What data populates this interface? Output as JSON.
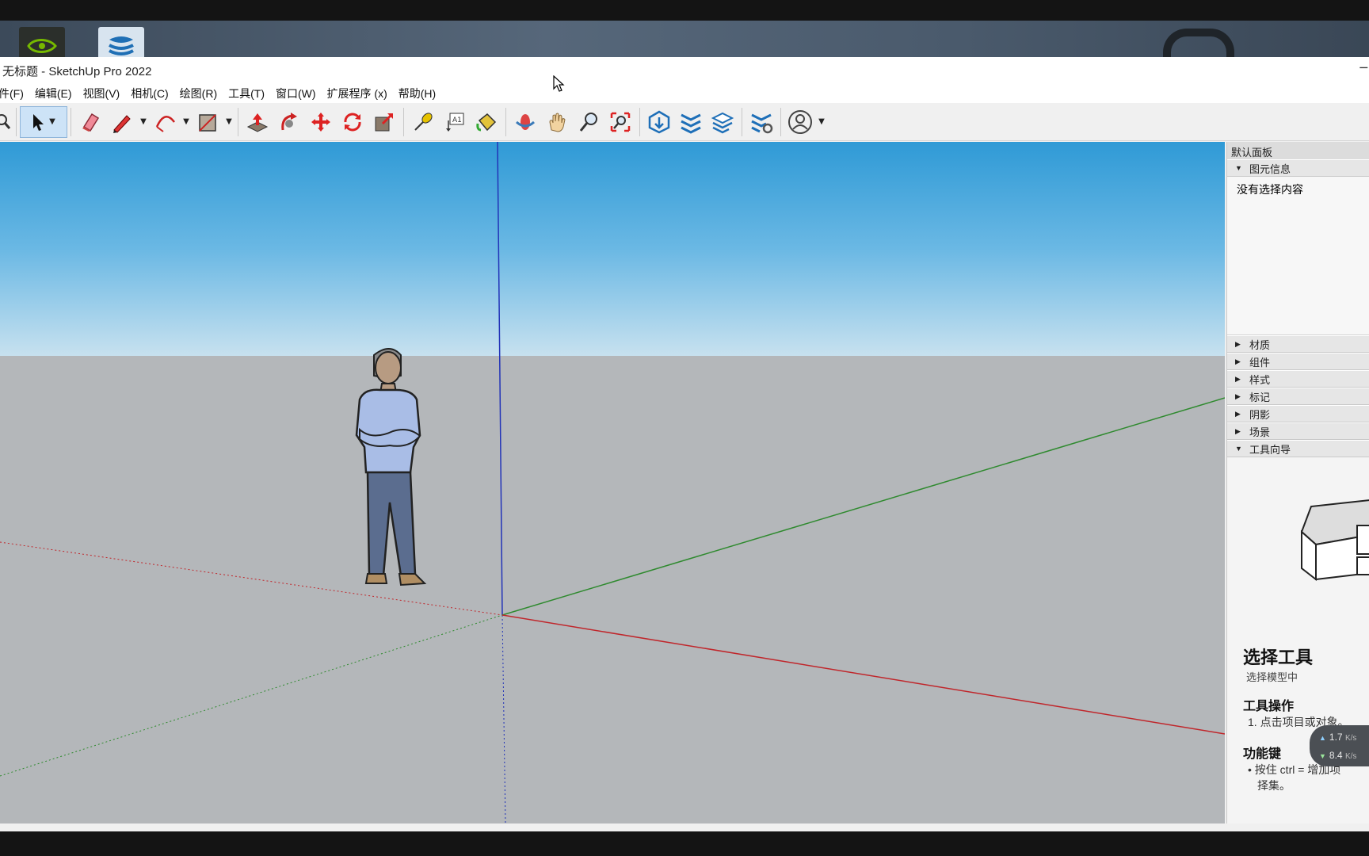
{
  "window": {
    "title": "无标题 - SketchUp Pro 2022",
    "minimize_glyph": "─"
  },
  "menu": [
    "件(F)",
    "编辑(E)",
    "视图(V)",
    "相机(C)",
    "绘图(R)",
    "工具(T)",
    "窗口(W)",
    "扩展程序 (x)",
    "帮助(H)"
  ],
  "toolbar": {
    "tools": [
      "zoom-icon",
      "select-icon",
      "eraser-icon",
      "pencil-icon",
      "arc-icon",
      "rectangle-icon",
      "push-pull-icon",
      "follow-me-icon",
      "move-icon",
      "rotate-icon",
      "scale-icon",
      "tape-measure-icon",
      "text-icon",
      "paint-bucket-icon",
      "orbit-icon",
      "pan-icon",
      "zoom-tool-icon",
      "zoom-extents-icon",
      "warehouse-icon",
      "extension-warehouse-icon",
      "layout-icon",
      "extension-manager-icon",
      "account-icon"
    ],
    "selected": "select-icon"
  },
  "viewport": {
    "axis_colors": {
      "red": "#c0262b",
      "green": "#2f8a2f",
      "blue": "#2233b8"
    },
    "sky_color": "#2f9ad6",
    "ground_color": "#b4b7ba"
  },
  "panel": {
    "title": "默认面板",
    "entity_info": {
      "label": "图元信息",
      "content": "没有选择内容"
    },
    "sections": [
      "材质",
      "组件",
      "样式",
      "标记",
      "阴影",
      "场景"
    ],
    "instructor": {
      "label": "工具向导",
      "tool_name": "选择工具",
      "tool_desc": "选择模型中",
      "ops_heading": "工具操作",
      "ops_item": "1. 点击项目或对象。",
      "keys_heading": "功能键",
      "keys_item_1": "• 按住 ctrl = 增加项",
      "keys_item_2": "择集。"
    }
  },
  "network": {
    "upload": "1.7",
    "download": "8.4",
    "unit": "K/s"
  }
}
